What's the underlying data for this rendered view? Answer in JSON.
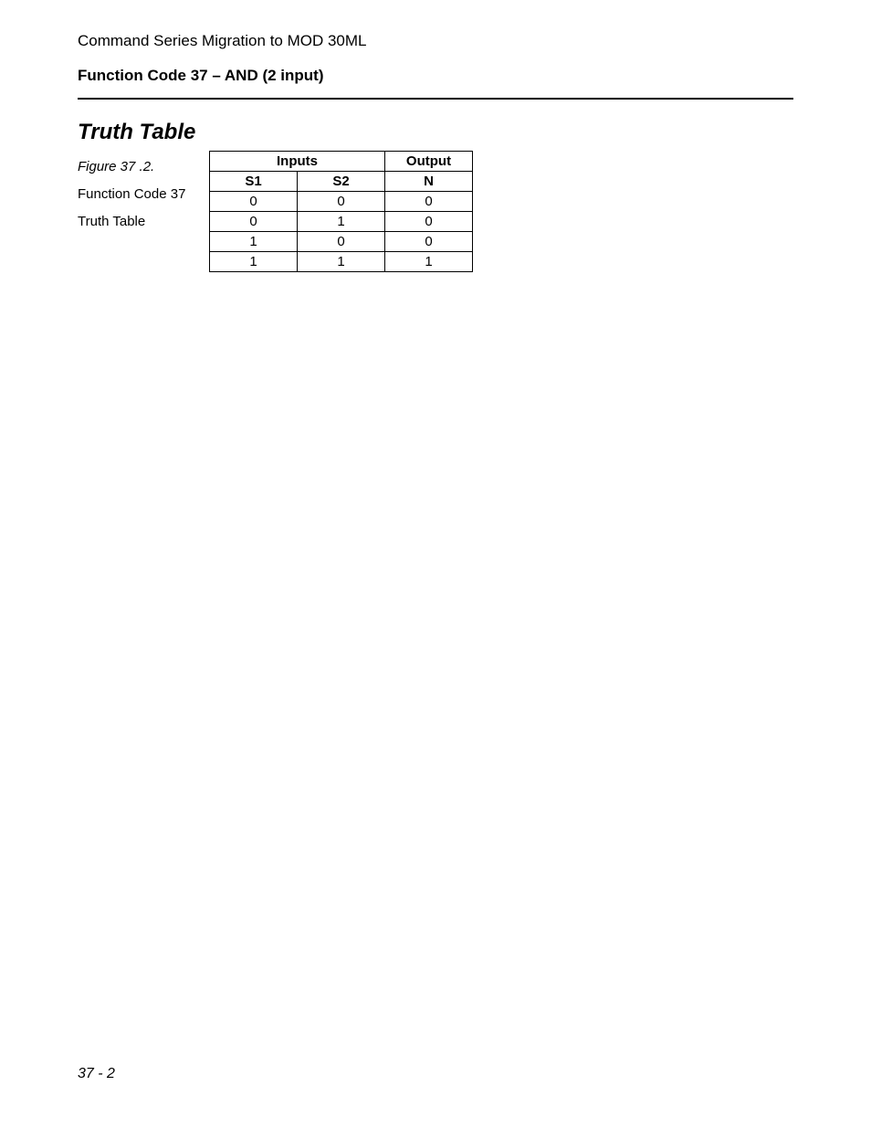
{
  "header": {
    "running_head": "Command Series Migration to MOD 30ML",
    "title": "Function Code 37 – AND (2 input)"
  },
  "section": {
    "heading": "Truth Table"
  },
  "caption": {
    "figure": "Figure 37 .2.",
    "line2": "Function Code 37",
    "line3": "Truth Table"
  },
  "chart_data": {
    "type": "table",
    "columns": {
      "inputs_header": "Inputs",
      "output_header": "Output",
      "s1": "S1",
      "s2": "S2",
      "n": "N"
    },
    "rows": [
      {
        "s1": "0",
        "s2": "0",
        "n": "0"
      },
      {
        "s1": "0",
        "s2": "1",
        "n": "0"
      },
      {
        "s1": "1",
        "s2": "0",
        "n": "0"
      },
      {
        "s1": "1",
        "s2": "1",
        "n": "1"
      }
    ]
  },
  "footer": {
    "page_number": "37 - 2"
  }
}
